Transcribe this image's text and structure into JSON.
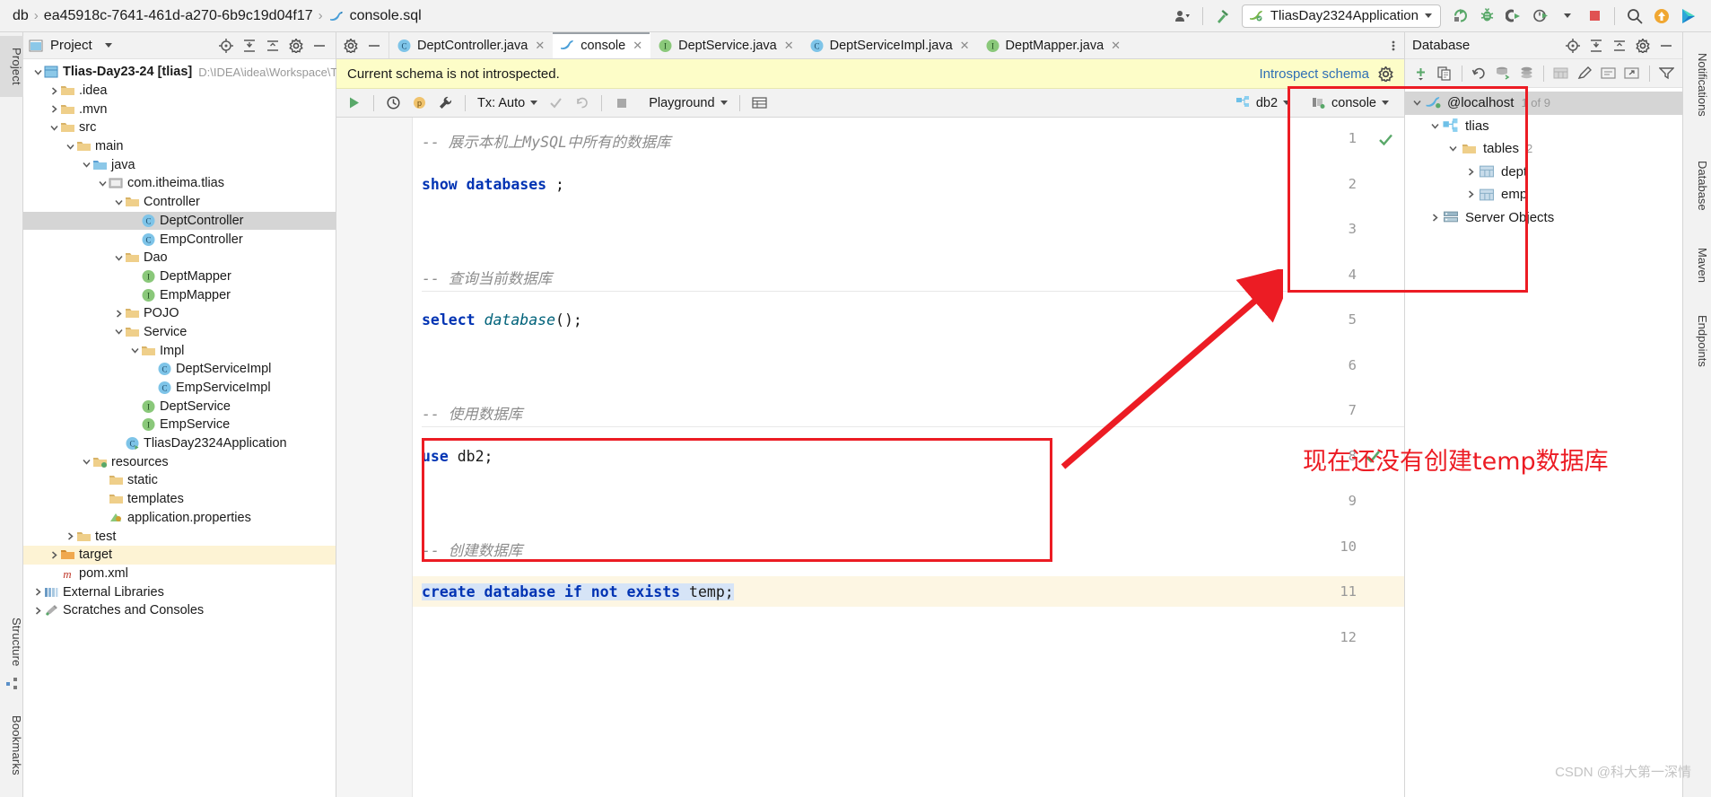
{
  "topbar": {
    "breadcrumb": [
      "db",
      "ea45918c-7641-461d-a270-6b9c19d04f17",
      "console.sql"
    ],
    "separator": "›",
    "run_config": "TliasDay2324Application",
    "icons": [
      "user-settings-icon",
      "hammer-build-icon",
      "rerun-icon",
      "debug-icon",
      "coverage-icon",
      "profiler-icon",
      "stop-icon",
      "search-icon",
      "update-icon",
      "ide-icon"
    ]
  },
  "left_stripe": {
    "tabs": [
      "Project",
      "Structure",
      "Bookmarks"
    ]
  },
  "project_panel": {
    "title": "Project",
    "head_icons": [
      "locate-icon",
      "expand-all-icon",
      "collapse-all-icon",
      "settings-icon",
      "hide-icon"
    ],
    "tree": [
      {
        "depth": 0,
        "label": "Tlias-Day23-24 [tlias]",
        "path": "D:\\IDEA\\idea\\Workspace\\Tlias",
        "icon": "module-icon",
        "arrow": "open",
        "bold": true
      },
      {
        "depth": 1,
        "label": ".idea",
        "icon": "folder-icon",
        "arrow": "closed"
      },
      {
        "depth": 1,
        "label": ".mvn",
        "icon": "folder-icon",
        "arrow": "closed"
      },
      {
        "depth": 1,
        "label": "src",
        "icon": "folder-icon",
        "arrow": "open"
      },
      {
        "depth": 2,
        "label": "main",
        "icon": "folder-icon",
        "arrow": "open"
      },
      {
        "depth": 3,
        "label": "java",
        "icon": "folder-blue-icon",
        "arrow": "open"
      },
      {
        "depth": 4,
        "label": "com.itheima.tlias",
        "icon": "package-icon",
        "arrow": "open"
      },
      {
        "depth": 5,
        "label": "Controller",
        "icon": "folder-icon",
        "arrow": "open"
      },
      {
        "depth": 6,
        "label": "DeptController",
        "icon": "class-icon",
        "selected": true
      },
      {
        "depth": 6,
        "label": "EmpController",
        "icon": "class-icon"
      },
      {
        "depth": 5,
        "label": "Dao",
        "icon": "folder-icon",
        "arrow": "open"
      },
      {
        "depth": 6,
        "label": "DeptMapper",
        "icon": "interface-icon"
      },
      {
        "depth": 6,
        "label": "EmpMapper",
        "icon": "interface-icon"
      },
      {
        "depth": 5,
        "label": "POJO",
        "icon": "folder-icon",
        "arrow": "closed"
      },
      {
        "depth": 5,
        "label": "Service",
        "icon": "folder-icon",
        "arrow": "open"
      },
      {
        "depth": 6,
        "label": "Impl",
        "icon": "folder-icon",
        "arrow": "open"
      },
      {
        "depth": 7,
        "label": "DeptServiceImpl",
        "icon": "class-icon"
      },
      {
        "depth": 7,
        "label": "EmpServiceImpl",
        "icon": "class-icon"
      },
      {
        "depth": 6,
        "label": "DeptService",
        "icon": "interface-icon"
      },
      {
        "depth": 6,
        "label": "EmpService",
        "icon": "interface-icon"
      },
      {
        "depth": 5,
        "label": "TliasDay2324Application",
        "icon": "class-run-icon"
      },
      {
        "depth": 3,
        "label": "resources",
        "icon": "folder-res-icon",
        "arrow": "open"
      },
      {
        "depth": 4,
        "label": "static",
        "icon": "folder-icon"
      },
      {
        "depth": 4,
        "label": "templates",
        "icon": "folder-icon"
      },
      {
        "depth": 4,
        "label": "application.properties",
        "icon": "properties-icon"
      },
      {
        "depth": 2,
        "label": "test",
        "icon": "folder-icon",
        "arrow": "closed"
      },
      {
        "depth": 1,
        "label": "target",
        "icon": "folder-orange-icon",
        "arrow": "closed",
        "highlight": true
      },
      {
        "depth": 1,
        "label": "pom.xml",
        "icon": "maven-icon"
      },
      {
        "depth": 0,
        "label": "External Libraries",
        "icon": "library-icon",
        "arrow": "closed"
      },
      {
        "depth": 0,
        "label": "Scratches and Consoles",
        "icon": "scratch-icon",
        "arrow": "closed"
      }
    ]
  },
  "editor": {
    "tabs": [
      {
        "label": "DeptController.java",
        "icon": "class-icon",
        "active": false
      },
      {
        "label": "console",
        "icon": "console-sql-icon",
        "active": true
      },
      {
        "label": "DeptService.java",
        "icon": "interface-icon",
        "active": false
      },
      {
        "label": "DeptServiceImpl.java",
        "icon": "class-icon",
        "active": false
      },
      {
        "label": "DeptMapper.java",
        "icon": "interface-icon",
        "active": false
      }
    ],
    "tab_close_glyph": "✕",
    "more_glyph": "⋮",
    "notification": {
      "message": "Current schema is not introspected.",
      "link": "Introspect schema",
      "gear": "gear-icon"
    },
    "sql_toolbar": {
      "run": "run-icon",
      "history": "history-icon",
      "params": "params-icon",
      "wrench": "wrench-icon",
      "tx_label": "Tx: Auto",
      "commit": "commit-icon",
      "rollback": "rollback-icon",
      "stop": "stop-icon",
      "schema_label": "Playground",
      "grid": "grid-icon",
      "datasource": "db2",
      "session": "console"
    },
    "code_lines": [
      {
        "num": "1",
        "type": "comment",
        "text": "-- 展示本机上MySQL中所有的数据库"
      },
      {
        "num": "2",
        "type": "sql",
        "kw": "show databases",
        "tail": " ;"
      },
      {
        "num": "3",
        "type": "blank",
        "text": ""
      },
      {
        "num": "4",
        "type": "comment",
        "text": "-- 查询当前数据库"
      },
      {
        "num": "5",
        "type": "select",
        "kw": "select ",
        "fn": "database",
        "tail": "();"
      },
      {
        "num": "6",
        "type": "blank",
        "text": ""
      },
      {
        "num": "7",
        "type": "comment",
        "text": "-- 使用数据库"
      },
      {
        "num": "8",
        "type": "use",
        "kw": "use ",
        "tail": "db2;",
        "mark": "check-icon"
      },
      {
        "num": "9",
        "type": "blank",
        "text": ""
      },
      {
        "num": "10",
        "type": "comment",
        "text": "-- 创建数据库"
      },
      {
        "num": "11",
        "type": "create",
        "kw": "create database if not exists ",
        "tail": "temp;",
        "selected": true
      },
      {
        "num": "12",
        "type": "blank",
        "text": ""
      }
    ]
  },
  "database_panel": {
    "title": "Database",
    "head_icons": [
      "locate-icon",
      "expand-all-icon",
      "collapse-all-icon",
      "settings-icon",
      "hide-icon"
    ],
    "toolbar_icons": [
      "add-icon",
      "copy-icon",
      "refresh-icon",
      "sync-schema-icon",
      "db-stack-icon",
      "table-icon",
      "edit-icon",
      "open-editor-icon",
      "jump-icon",
      "filter-icon"
    ],
    "tree": [
      {
        "depth": 0,
        "label": "@localhost",
        "count": "1 of 9",
        "icon": "mysql-icon",
        "arrow": "open",
        "selected": true
      },
      {
        "depth": 1,
        "label": "tlias",
        "icon": "schema-icon",
        "arrow": "open"
      },
      {
        "depth": 2,
        "label": "tables",
        "count": "2",
        "icon": "folder-icon",
        "arrow": "open"
      },
      {
        "depth": 3,
        "label": "dept",
        "icon": "table-icon",
        "arrow": "closed"
      },
      {
        "depth": 3,
        "label": "emp",
        "icon": "table-icon",
        "arrow": "closed"
      },
      {
        "depth": 1,
        "label": "Server Objects",
        "icon": "server-objects-icon",
        "arrow": "closed"
      }
    ]
  },
  "right_stripe": {
    "tabs": [
      "Notifications",
      "Database",
      "Maven",
      "Endpoints"
    ]
  },
  "annotations": {
    "note_text": "现在还没有创建temp数据库",
    "note_color": "#ec1c24",
    "arrow_name": "red-arrow-annotation",
    "box_code_name": "red-box-code-highlight",
    "box_db_name": "red-box-database-tree"
  },
  "watermark": "CSDN @科大第一深情"
}
